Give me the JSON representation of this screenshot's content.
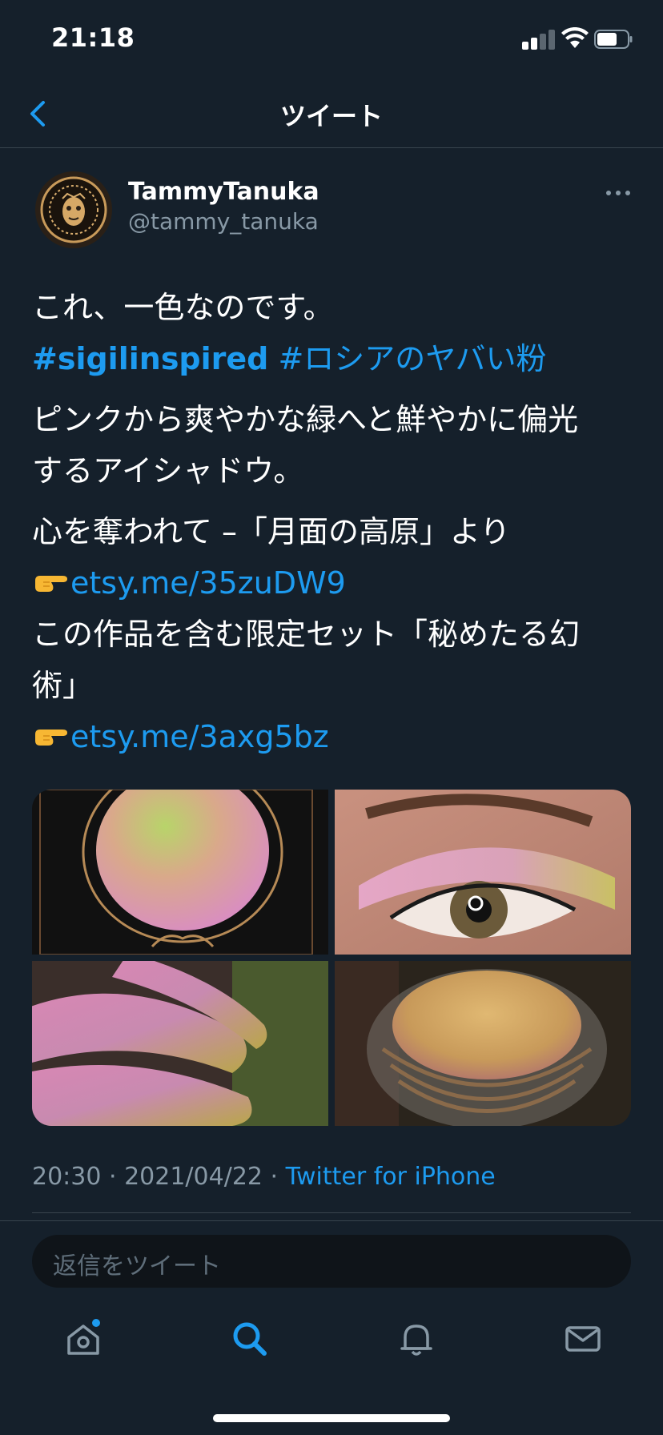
{
  "status_bar": {
    "time": "21:18",
    "signal_bars": 2,
    "battery_level": 0.6
  },
  "header": {
    "title": "ツイート"
  },
  "tweet": {
    "author": {
      "name": "TammyTanuka",
      "handle": "@tammy_tanuka"
    },
    "text": {
      "line1": "これ、一色なのです。",
      "hashtag1": "#sigilinspired",
      "hashtag2": "#ロシアのヤバい粉",
      "line3a": "ピンクから爽やかな緑へと鮮やかに偏光",
      "line3b": "するアイシャドウ。",
      "line4": "心を奪われて –「月面の高原」より",
      "link1": "etsy.me/35zuDW9",
      "line6a": "この作品を含む限定セット「秘めたる幻",
      "line6b": "術」",
      "link2": "etsy.me/3axg5bz"
    },
    "meta": {
      "time": "20:30",
      "separator1": " · ",
      "date": "2021/04/22",
      "separator2": " · ",
      "source": "Twitter for iPhone"
    }
  },
  "reply": {
    "placeholder": "返信をツイート"
  },
  "icons": {
    "back": "chevron-left-icon",
    "more": "more-horizontal-icon",
    "pointer": "backhand-index-pointing-right-emoji",
    "tabs": [
      "home-icon",
      "search-icon",
      "bell-icon",
      "mail-icon"
    ]
  },
  "colors": {
    "background": "#15202b",
    "accent": "#1d9bf0",
    "muted": "#8899a6",
    "divider": "#38444d"
  },
  "tabbar": {
    "active_tab": "search",
    "home_notification_dot": true
  }
}
